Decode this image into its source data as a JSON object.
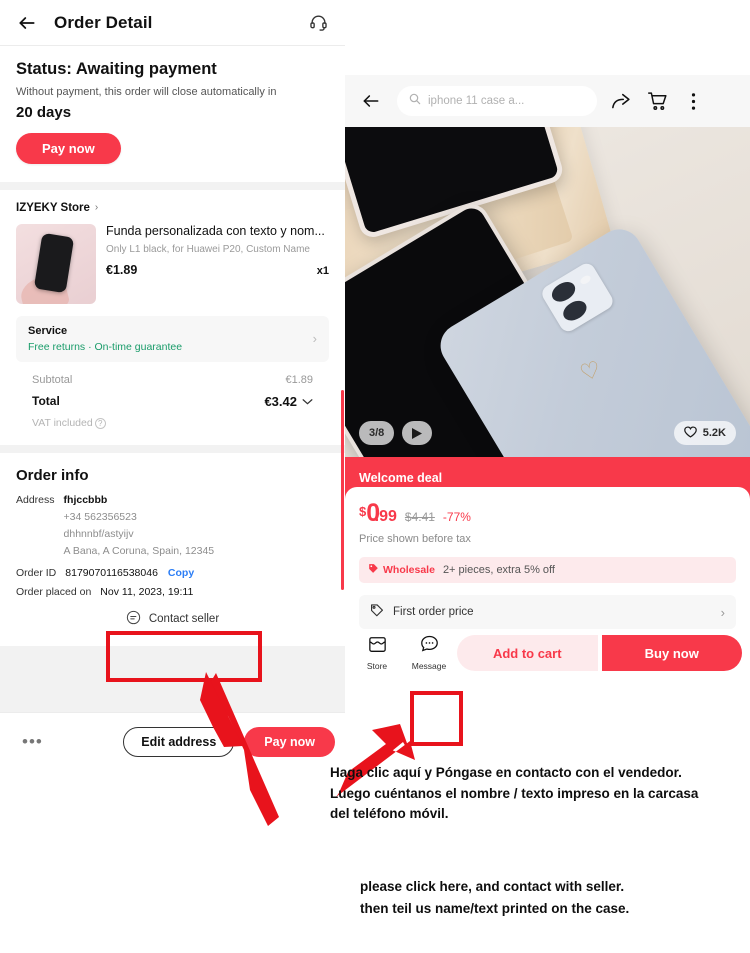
{
  "order_detail": {
    "header": {
      "back_icon": "back-arrow-icon",
      "title": "Order Detail",
      "support_icon": "headset-support-icon"
    },
    "status": {
      "title": "Status: Awaiting payment",
      "subtitle": "Without payment, this order will close automatically in",
      "countdown": "20 days",
      "pay_button": "Pay now"
    },
    "store": {
      "name": "IZYEKY Store",
      "chevron": "›"
    },
    "product": {
      "title": "Funda personalizada con texto y nom...",
      "variant": "Only L1 black, for Huawei P20, Custom Name",
      "price": "€1.89",
      "quantity": "x1"
    },
    "service": {
      "label": "Service",
      "value": "Free returns · On-time guarantee",
      "chevron": "›"
    },
    "totals": {
      "subtotal_label": "Subtotal",
      "subtotal_value": "€1.89",
      "total_label": "Total",
      "total_value": "€3.42",
      "total_chevron": "⌄",
      "vat_label": "VAT included"
    },
    "order_info": {
      "heading": "Order info",
      "address_label": "Address",
      "address_name": "fhjccbbb",
      "address_phone": "+34 562356523",
      "address_line1": "dhhnnbf/astyijv",
      "address_line2": "A Bana, A Coruna, Spain, 12345",
      "order_id_label": "Order ID",
      "order_id_value": "8179070116538046",
      "copy_label": "Copy",
      "placed_label": "Order placed on",
      "placed_value": "Nov 11, 2023, 19:11",
      "contact_seller": "Contact seller"
    },
    "bottom_bar": {
      "more_dots": "•••",
      "edit_address": "Edit address",
      "pay_now": "Pay now"
    }
  },
  "product_detail": {
    "header": {
      "back_icon": "back-arrow-icon",
      "search_icon": "search-icon",
      "search_value": "iphone 11 case a...",
      "share_icon": "share-icon",
      "cart_icon": "cart-icon",
      "more_icon": "more-vertical-icon"
    },
    "gallery": {
      "counter": "3/8",
      "play_icon": "▶",
      "heart_icon": "heart-outline-icon",
      "likes": "5.2K"
    },
    "deal": {
      "banner": "Welcome deal",
      "currency": "$",
      "price_int": "0",
      "price_dec": ".99",
      "old_price": "$4.41",
      "discount": "-77%",
      "tax_note": "Price shown before tax"
    },
    "wholesale": {
      "tag": "Wholesale",
      "text": "2+ pieces, extra 5% off"
    },
    "first_order": {
      "label": "First order price",
      "chevron": "›"
    },
    "bottom_bar": {
      "store_label": "Store",
      "message_label": "Message",
      "add_to_cart": "Add to cart",
      "buy_now": "Buy now"
    }
  },
  "annotations": {
    "spanish_line1": "Haga clic aquí y Póngase en contacto con el vendedor.",
    "spanish_line2": "Luego cuéntanos el nombre / texto impreso en la carcasa",
    "spanish_line3": "del teléfono móvil.",
    "english_line1": "please click here, and contact with seller.",
    "english_line2": "then teil us name/text printed on the case."
  },
  "colors": {
    "accent_red": "#f8394a",
    "annotation_red": "#e8131c",
    "link_blue": "#2b7df5",
    "service_green": "#1a9c6a"
  }
}
